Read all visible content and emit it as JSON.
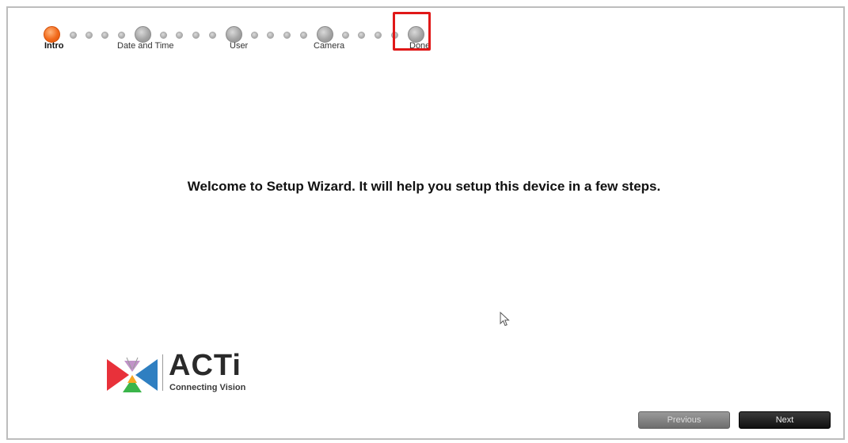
{
  "wizard": {
    "steps": [
      {
        "label": "Intro",
        "state": "active"
      },
      {
        "label": "Date and Time",
        "state": "pending"
      },
      {
        "label": "User",
        "state": "pending"
      },
      {
        "label": "Camera",
        "state": "pending"
      },
      {
        "label": "Done",
        "state": "pending",
        "highlighted": true
      }
    ],
    "welcome_text": "Welcome to Setup Wizard. It will help you setup this device in a few steps."
  },
  "logo": {
    "brand": "ACTi",
    "tagline": "Connecting Vision"
  },
  "buttons": {
    "previous_label": "Previous",
    "next_label": "Next"
  },
  "colors": {
    "active_step": "#f26a1b",
    "highlight_box": "#e01818",
    "logo_red": "#e8313a",
    "logo_blue": "#2f7fc1",
    "logo_green": "#3ab54a",
    "logo_purple": "#8e3a9a"
  }
}
